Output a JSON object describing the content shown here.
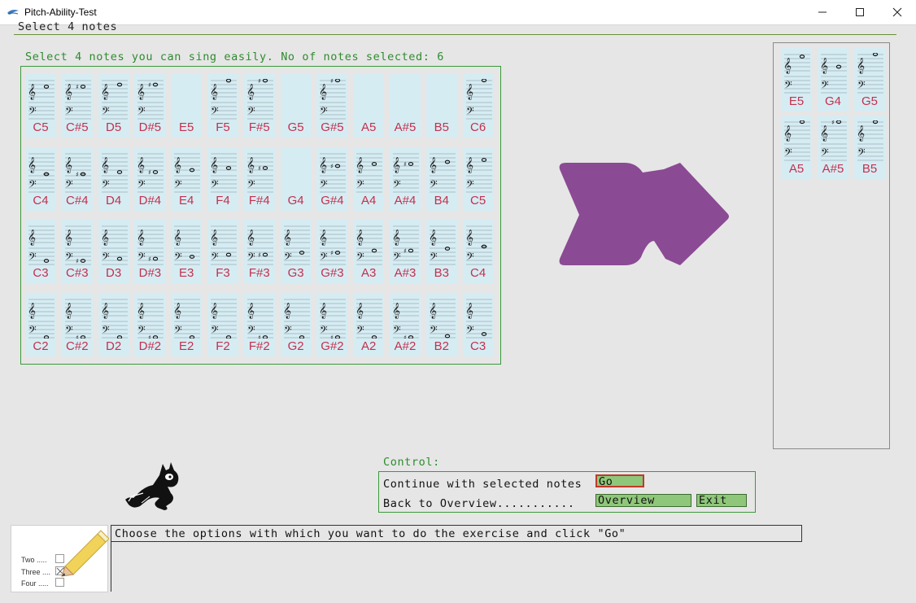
{
  "window": {
    "title": "Pitch-Ability-Test",
    "minimize_glyph": "—",
    "maximize_glyph": "☐",
    "close_glyph": "✕"
  },
  "header": {
    "text": "Select 4 notes"
  },
  "selection": {
    "label": "Select 4 notes you can sing easily. No of notes selected: 6"
  },
  "notes_grid": {
    "rows": [
      [
        "C5",
        "C#5",
        "D5",
        "D#5",
        "E5",
        "F5",
        "F#5",
        "G5",
        "G#5",
        "A5",
        "A#5",
        "B5",
        "C6"
      ],
      [
        "C4",
        "C#4",
        "D4",
        "D#4",
        "E4",
        "F4",
        "F#4",
        "G4",
        "G#4",
        "A4",
        "A#4",
        "B4",
        "C5"
      ],
      [
        "C3",
        "C#3",
        "D3",
        "D#3",
        "E3",
        "F3",
        "F#3",
        "G3",
        "G#3",
        "A3",
        "A#3",
        "B3",
        "C4"
      ],
      [
        "C2",
        "C#2",
        "D2",
        "D#2",
        "E2",
        "F2",
        "F#2",
        "G2",
        "G#2",
        "A2",
        "A#2",
        "B2",
        "C3"
      ]
    ],
    "empty_staff_cells": [
      "E5",
      "G5",
      "A5",
      "A#5",
      "B5",
      "G4"
    ]
  },
  "selected_notes": [
    "E5",
    "G4",
    "G5",
    "A5",
    "A#5",
    "B5"
  ],
  "arrow_color": "#8b4a94",
  "control": {
    "label": "Control:",
    "continue_text": "Continue with selected notes",
    "back_text": "Back to Overview...........",
    "go_label": "Go",
    "overview_label": "Overview",
    "exit_label": "Exit"
  },
  "options_image": {
    "items": [
      "Two .....",
      "Three ....",
      "Four ....."
    ]
  },
  "message": "Choose the options with which you want to do the exercise and click \"Go\""
}
